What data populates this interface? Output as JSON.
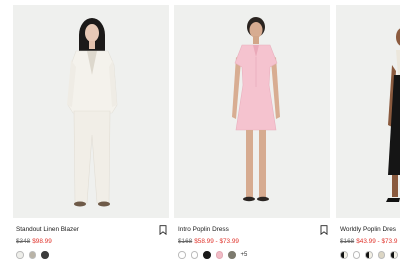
{
  "products": [
    {
      "name": "Standout Linen Blazer",
      "old_price": "$348",
      "price": "$98.99",
      "swatches": [
        "#eeeeea",
        "#b9b3a6",
        "#3c3c3c"
      ],
      "more": ""
    },
    {
      "name": "Intro Poplin Dress",
      "old_price": "$168",
      "price": "$58.99 - $73.99",
      "swatches": [
        "#ffffff",
        "#ffffff",
        "#1a1a1a",
        "#f1bcc6",
        "#7d7a6e"
      ],
      "more": "+5"
    },
    {
      "name": "Worldly Poplin Dres",
      "old_price": "$168",
      "price": "$43.99 - $73.9",
      "swatches": [
        "half",
        "#ffffff",
        "half",
        "#dcd6c4",
        "half"
      ],
      "more": ""
    }
  ],
  "icons": {
    "bookmark": "bookmark-icon"
  },
  "colors": {
    "sale": "#e0332b",
    "photo_bg": "#eff0ee"
  }
}
